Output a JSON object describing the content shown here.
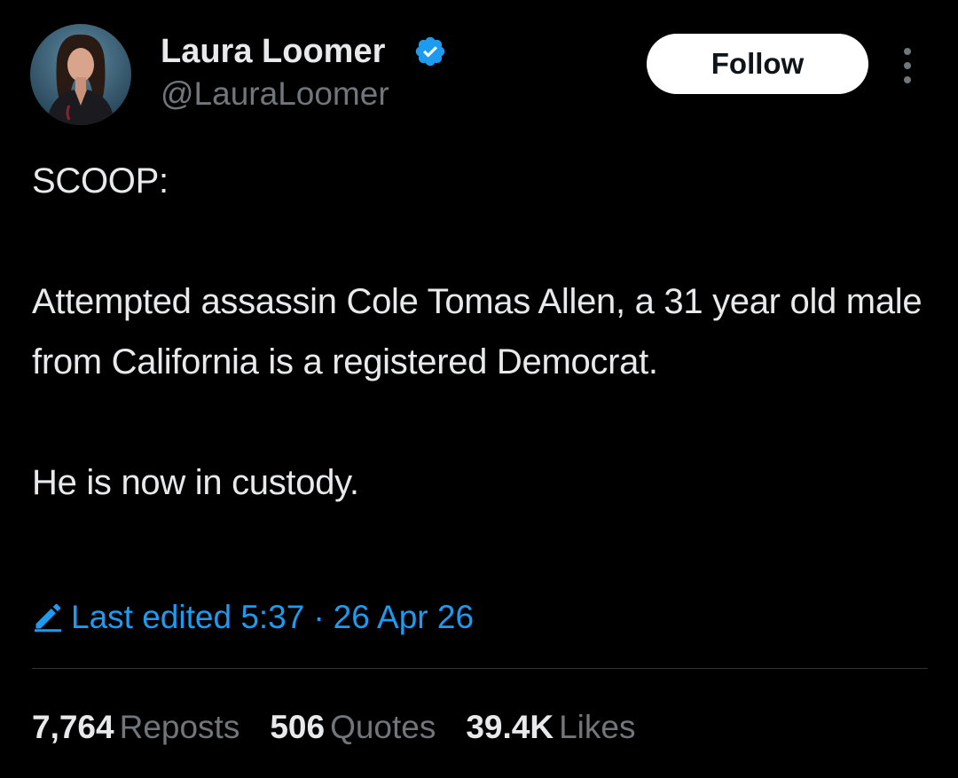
{
  "author": {
    "display_name": "Laura Loomer",
    "handle": "@LauraLoomer",
    "verified_icon": "verified-badge-icon"
  },
  "actions": {
    "follow_label": "Follow",
    "more_icon": "more-options-icon"
  },
  "tweet": {
    "paragraphs": [
      "SCOOP:",
      "Attempted assassin Cole Tomas Allen, a 31 year old male from California is a registered Democrat.",
      "He is now in custody."
    ]
  },
  "edited": {
    "label": "Last edited",
    "time": "5:37",
    "separator": "·",
    "date": "26 Apr 26",
    "icon": "pencil-icon"
  },
  "stats": [
    {
      "count": "7,764",
      "label": "Reposts"
    },
    {
      "count": "506",
      "label": "Quotes"
    },
    {
      "count": "39.4K",
      "label": "Likes"
    }
  ],
  "colors": {
    "background": "#000000",
    "text": "#e7e9ea",
    "secondary": "#71767b",
    "accent": "#1d9bf0",
    "divider": "#2f3336",
    "button_bg": "#ffffff"
  }
}
